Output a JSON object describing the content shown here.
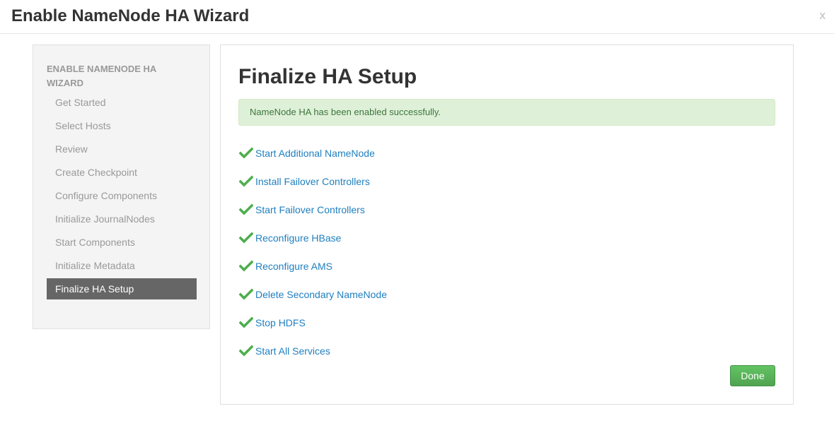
{
  "modal": {
    "title": "Enable NameNode HA Wizard",
    "close_label": "x"
  },
  "nav": {
    "header": "ENABLE NAMENODE HA WIZARD",
    "items": [
      {
        "label": "Get Started",
        "active": false
      },
      {
        "label": "Select Hosts",
        "active": false
      },
      {
        "label": "Review",
        "active": false
      },
      {
        "label": "Create Checkpoint",
        "active": false
      },
      {
        "label": "Configure Components",
        "active": false
      },
      {
        "label": "Initialize JournalNodes",
        "active": false
      },
      {
        "label": "Start Components",
        "active": false
      },
      {
        "label": "Initialize Metadata",
        "active": false
      },
      {
        "label": "Finalize HA Setup",
        "active": true
      }
    ]
  },
  "main": {
    "title": "Finalize HA Setup",
    "alert": "NameNode HA has been enabled successfully.",
    "tasks": [
      {
        "label": "Start Additional NameNode",
        "icon": "check-icon",
        "status": "completed"
      },
      {
        "label": "Install Failover Controllers",
        "icon": "check-icon",
        "status": "completed"
      },
      {
        "label": "Start Failover Controllers",
        "icon": "check-icon",
        "status": "completed"
      },
      {
        "label": "Reconfigure HBase",
        "icon": "check-icon",
        "status": "completed"
      },
      {
        "label": "Reconfigure AMS",
        "icon": "check-icon",
        "status": "completed"
      },
      {
        "label": "Delete Secondary NameNode",
        "icon": "check-icon",
        "status": "completed"
      },
      {
        "label": "Stop HDFS",
        "icon": "check-icon",
        "status": "completed"
      },
      {
        "label": "Start All Services",
        "icon": "check-icon",
        "status": "completed"
      }
    ],
    "done_label": "Done"
  },
  "colors": {
    "check": "#4cae4c",
    "link": "#1f7fbf",
    "active_nav_bg": "#666666",
    "success_bg": "#dff0d8",
    "done_button": "#5bb75b"
  }
}
